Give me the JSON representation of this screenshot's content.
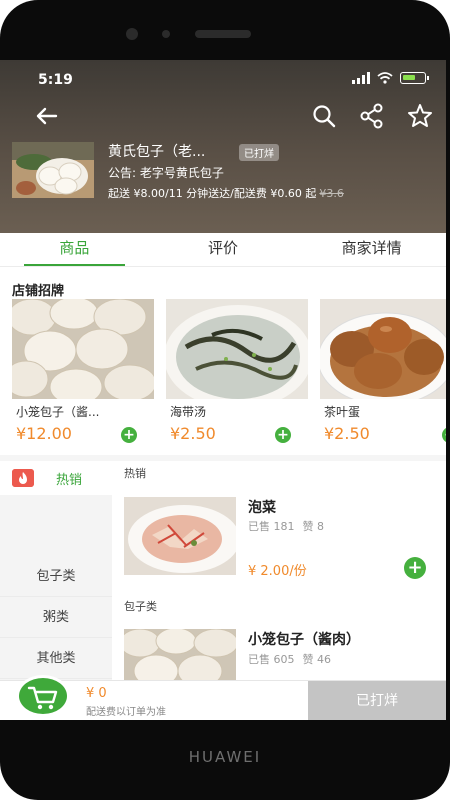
{
  "status_bar": {
    "time": "5:19"
  },
  "shop": {
    "name": "黄氏包子（老...",
    "status_tag": "已打烊",
    "notice": "公告: 老字号黄氏包子",
    "delivery_info": "起送 ¥8.00/11 分钟送达/配送费 ¥0.60 起",
    "old_fee": "¥3.6"
  },
  "tabs": [
    {
      "label": "商品",
      "active": true
    },
    {
      "label": "评价",
      "active": false
    },
    {
      "label": "商家详情",
      "active": false
    }
  ],
  "signature": {
    "title": "店铺招牌",
    "items": [
      {
        "name": "小笼包子（酱...",
        "price": "¥12.00"
      },
      {
        "name": "海带汤",
        "price": "¥2.50"
      },
      {
        "name": "茶叶蛋",
        "price": "¥2.50"
      }
    ]
  },
  "sidebar": {
    "hot_label": "热销",
    "items": [
      "包子类",
      "粥类",
      "其他类"
    ]
  },
  "product_list": {
    "sections": [
      {
        "label": "热销",
        "product": {
          "name": "泡菜",
          "sold": "已售 181",
          "likes": "赞 8",
          "price": "¥ 2.00/份"
        }
      },
      {
        "label": "包子类",
        "product": {
          "name": "小笼包子（酱肉）",
          "sold": "已售 605",
          "likes": "赞 46"
        }
      }
    ]
  },
  "cart": {
    "amount": "¥ 0",
    "note": "配送费以订单为准",
    "checkout_label": "已打烊"
  },
  "device": {
    "brand": "HUAWEI"
  },
  "colors": {
    "accent_green": "#3aa53a",
    "price_orange": "#f08a2c",
    "header_brown": "#5a5046"
  }
}
